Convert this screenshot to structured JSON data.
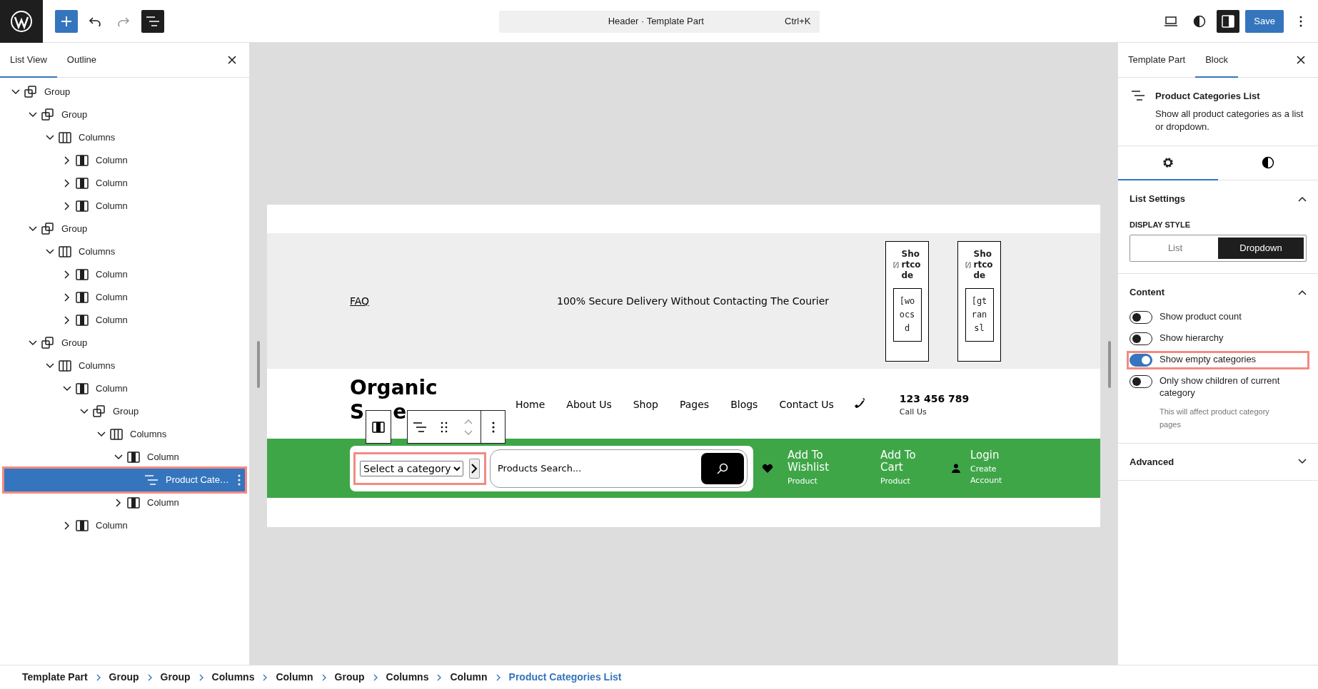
{
  "topbar": {
    "command_title": "Header · Template Part",
    "shortcut": "Ctrl+K",
    "save": "Save",
    "list_view_selected": true,
    "sidebar_selected": true
  },
  "left_panel": {
    "tabs": [
      {
        "label": "List View",
        "selected": true
      },
      {
        "label": "Outline",
        "selected": false
      }
    ],
    "tree": [
      {
        "label": "Group",
        "kind": "group",
        "expanded": true,
        "selected": false,
        "highlighted": false,
        "children": [
          {
            "label": "Group",
            "kind": "group",
            "expanded": true,
            "selected": false,
            "highlighted": false,
            "children": [
              {
                "label": "Columns",
                "kind": "columns",
                "expanded": true,
                "selected": false,
                "highlighted": false,
                "children": [
                  {
                    "label": "Column",
                    "kind": "column",
                    "expanded": false,
                    "selected": false,
                    "highlighted": false
                  },
                  {
                    "label": "Column",
                    "kind": "column",
                    "expanded": false,
                    "selected": false,
                    "highlighted": false
                  },
                  {
                    "label": "Column",
                    "kind": "column",
                    "expanded": false,
                    "selected": false,
                    "highlighted": false
                  }
                ]
              }
            ]
          },
          {
            "label": "Group",
            "kind": "group",
            "expanded": true,
            "selected": false,
            "highlighted": false,
            "children": [
              {
                "label": "Columns",
                "kind": "columns",
                "expanded": true,
                "selected": false,
                "highlighted": false,
                "children": [
                  {
                    "label": "Column",
                    "kind": "column",
                    "expanded": false,
                    "selected": false,
                    "highlighted": false
                  },
                  {
                    "label": "Column",
                    "kind": "column",
                    "expanded": false,
                    "selected": false,
                    "highlighted": false
                  },
                  {
                    "label": "Column",
                    "kind": "column",
                    "expanded": false,
                    "selected": false,
                    "highlighted": false
                  }
                ]
              }
            ]
          },
          {
            "label": "Group",
            "kind": "group",
            "expanded": true,
            "selected": false,
            "highlighted": false,
            "children": [
              {
                "label": "Columns",
                "kind": "columns",
                "expanded": true,
                "selected": false,
                "highlighted": false,
                "children": [
                  {
                    "label": "Column",
                    "kind": "column",
                    "expanded": true,
                    "selected": false,
                    "highlighted": false,
                    "children": [
                      {
                        "label": "Group",
                        "kind": "group",
                        "expanded": true,
                        "selected": false,
                        "highlighted": false,
                        "children": [
                          {
                            "label": "Columns",
                            "kind": "columns",
                            "expanded": true,
                            "selected": false,
                            "highlighted": false,
                            "children": [
                              {
                                "label": "Column",
                                "kind": "column",
                                "expanded": true,
                                "selected": false,
                                "highlighted": false,
                                "children": [
                                  {
                                    "label": "Product Cate…",
                                    "kind": "list",
                                    "selected": true,
                                    "highlighted": true
                                  }
                                ]
                              },
                              {
                                "label": "Column",
                                "kind": "column",
                                "expanded": false,
                                "selected": false,
                                "highlighted": false
                              }
                            ]
                          }
                        ]
                      }
                    ]
                  },
                  {
                    "label": "Column",
                    "kind": "column",
                    "expanded": false,
                    "selected": false,
                    "highlighted": false
                  }
                ]
              }
            ]
          }
        ]
      }
    ]
  },
  "canvas": {
    "top_bar": {
      "link": "FAQ",
      "message": "100% Secure Delivery Without Contacting The Courier",
      "shortcodes": [
        {
          "title": "Shortcode",
          "code": "[woocsd"
        },
        {
          "title": "Shortcode",
          "code": "[gtransl"
        }
      ]
    },
    "header": {
      "logo": "Organic",
      "logo_fragments": [
        "S",
        "e"
      ],
      "nav": [
        "Home",
        "About Us",
        "Shop",
        "Pages",
        "Blogs",
        "Contact Us"
      ],
      "phone": "123 456 789",
      "phone_label": "Call Us"
    },
    "bottom_bar": {
      "category_select": {
        "value": "Select a category",
        "highlighted": true
      },
      "search": {
        "placeholder": "Products Search..."
      },
      "actions": [
        {
          "kind": "wishlist",
          "title": "Add To Wishlist",
          "subtitle": "Product"
        },
        {
          "kind": "cart",
          "title": "Add To Cart",
          "subtitle": "Product"
        },
        {
          "kind": "login",
          "title": "Login",
          "subtitle": "Create Account"
        }
      ]
    }
  },
  "right_panel": {
    "tabs": [
      {
        "label": "Template Part",
        "selected": false
      },
      {
        "label": "Block",
        "selected": true
      }
    ],
    "block": {
      "title": "Product Categories List",
      "description": "Show all product categories as a list or dropdown."
    },
    "block_tabs": [
      {
        "kind": "settings",
        "selected": true
      },
      {
        "kind": "styles",
        "selected": false
      }
    ],
    "sections": [
      {
        "kind": "display",
        "title": "List Settings",
        "expanded": true,
        "label": "DISPLAY STYLE",
        "options": [
          {
            "label": "List",
            "selected": false
          },
          {
            "label": "Dropdown",
            "selected": true
          }
        ]
      },
      {
        "kind": "toggles",
        "title": "Content",
        "expanded": true,
        "toggles": [
          {
            "label": "Show product count",
            "on": false,
            "highlighted": false
          },
          {
            "label": "Show hierarchy",
            "on": false,
            "highlighted": false
          },
          {
            "label": "Show empty categories",
            "on": true,
            "highlighted": true
          },
          {
            "label": "Only show children of current category",
            "on": false,
            "highlighted": false,
            "help": "This will affect product category pages"
          }
        ]
      },
      {
        "title": "Advanced",
        "expanded": false
      }
    ]
  },
  "breadcrumb": [
    {
      "label": "Template Part",
      "current": false
    },
    {
      "label": "Group",
      "current": false
    },
    {
      "label": "Group",
      "current": false
    },
    {
      "label": "Columns",
      "current": false
    },
    {
      "label": "Column",
      "current": false
    },
    {
      "label": "Group",
      "current": false
    },
    {
      "label": "Columns",
      "current": false
    },
    {
      "label": "Column",
      "current": false
    },
    {
      "label": "Product Categories List",
      "current": true
    }
  ]
}
